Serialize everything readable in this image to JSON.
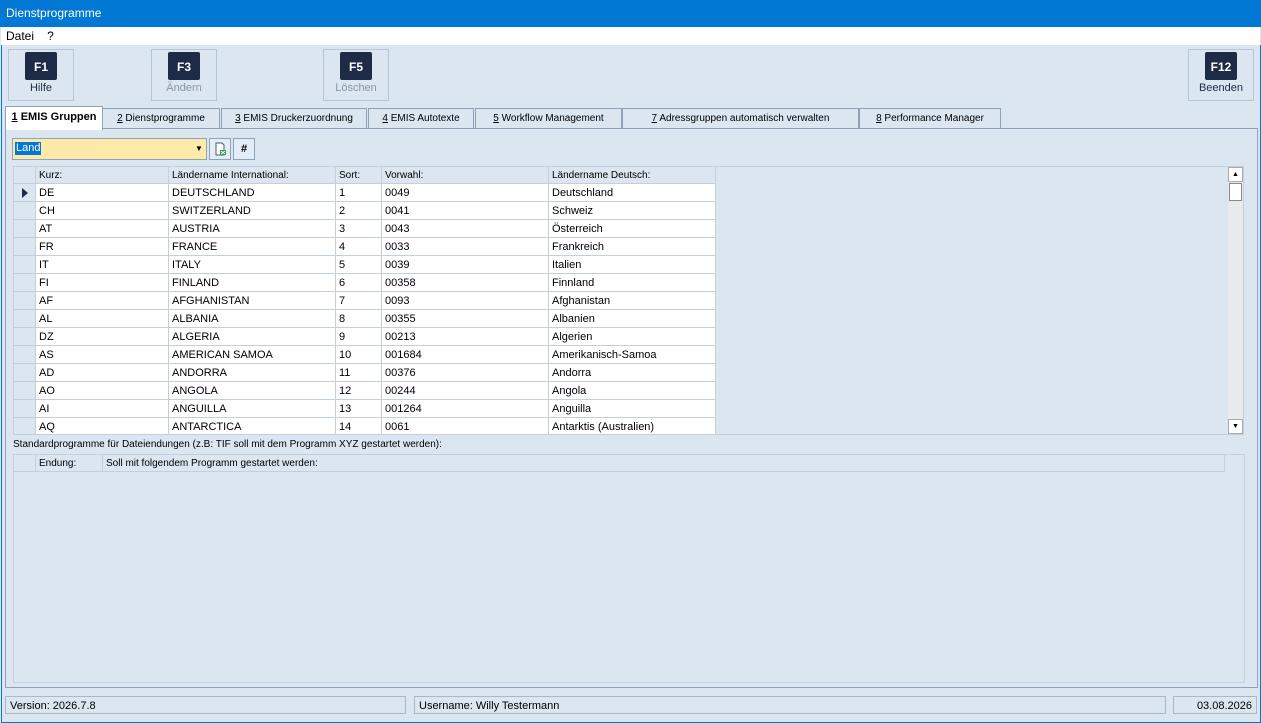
{
  "window": {
    "title": "Dienstprogramme"
  },
  "menu": [
    "Datei",
    "?"
  ],
  "toolbar": {
    "f1": {
      "key": "F1",
      "label": "Hilfe"
    },
    "f3": {
      "key": "F3",
      "label": "Ändern"
    },
    "f5": {
      "key": "F5",
      "label": "Löschen"
    },
    "f12": {
      "key": "F12",
      "label": "Beenden"
    }
  },
  "tabs": [
    {
      "num": "1",
      "label": " EMIS Gruppen"
    },
    {
      "num": "2",
      "label": " Dienstprogramme"
    },
    {
      "num": "3",
      "label": " EMIS Druckerzuordnung"
    },
    {
      "num": "4",
      "label": " EMIS Autotexte"
    },
    {
      "num": "5",
      "label": " Workflow Management"
    },
    {
      "num": "7",
      "label": " Adressgruppen automatisch verwalten"
    },
    {
      "num": "8",
      "label": " Performance Manager"
    }
  ],
  "filter": {
    "selected": "Land",
    "hash_label": "#"
  },
  "grid": {
    "columns": [
      "Kurz:",
      "Ländername International:",
      "Sort:",
      "Vorwahl:",
      "Ländername Deutsch:"
    ],
    "rows": [
      [
        "DE",
        "DEUTSCHLAND",
        "1",
        "0049",
        "Deutschland"
      ],
      [
        "CH",
        "SWITZERLAND",
        "2",
        "0041",
        "Schweiz"
      ],
      [
        "AT",
        "AUSTRIA",
        "3",
        "0043",
        "Österreich"
      ],
      [
        "FR",
        "FRANCE",
        "4",
        "0033",
        "Frankreich"
      ],
      [
        "IT",
        "ITALY",
        "5",
        "0039",
        "Italien"
      ],
      [
        "FI",
        "FINLAND",
        "6",
        "00358",
        "Finnland"
      ],
      [
        "AF",
        "AFGHANISTAN",
        "7",
        "0093",
        "Afghanistan"
      ],
      [
        "AL",
        "ALBANIA",
        "8",
        "00355",
        "Albanien"
      ],
      [
        "DZ",
        "ALGERIA",
        "9",
        "00213",
        "Algerien"
      ],
      [
        "AS",
        "AMERICAN SAMOA",
        "10",
        "001684",
        "Amerikanisch-Samoa"
      ],
      [
        "AD",
        "ANDORRA",
        "11",
        "00376",
        "Andorra"
      ],
      [
        "AO",
        "ANGOLA",
        "12",
        "00244",
        "Angola"
      ],
      [
        "AI",
        "ANGUILLA",
        "13",
        "001264",
        "Anguilla"
      ],
      [
        "AQ",
        "ANTARCTICA",
        "14",
        "0061",
        "Antarktis (Australien)"
      ]
    ]
  },
  "section2": {
    "label": "Standardprogramme für Dateiendungen (z.B: TIF soll mit dem Programm XYZ gestartet werden):",
    "columns": [
      "Endung:",
      "Soll mit folgendem Programm gestartet werden:"
    ]
  },
  "status": {
    "version": "Version: 2026.7.8",
    "user": "Username: Willy Testermann",
    "date": "03.08.2026"
  }
}
